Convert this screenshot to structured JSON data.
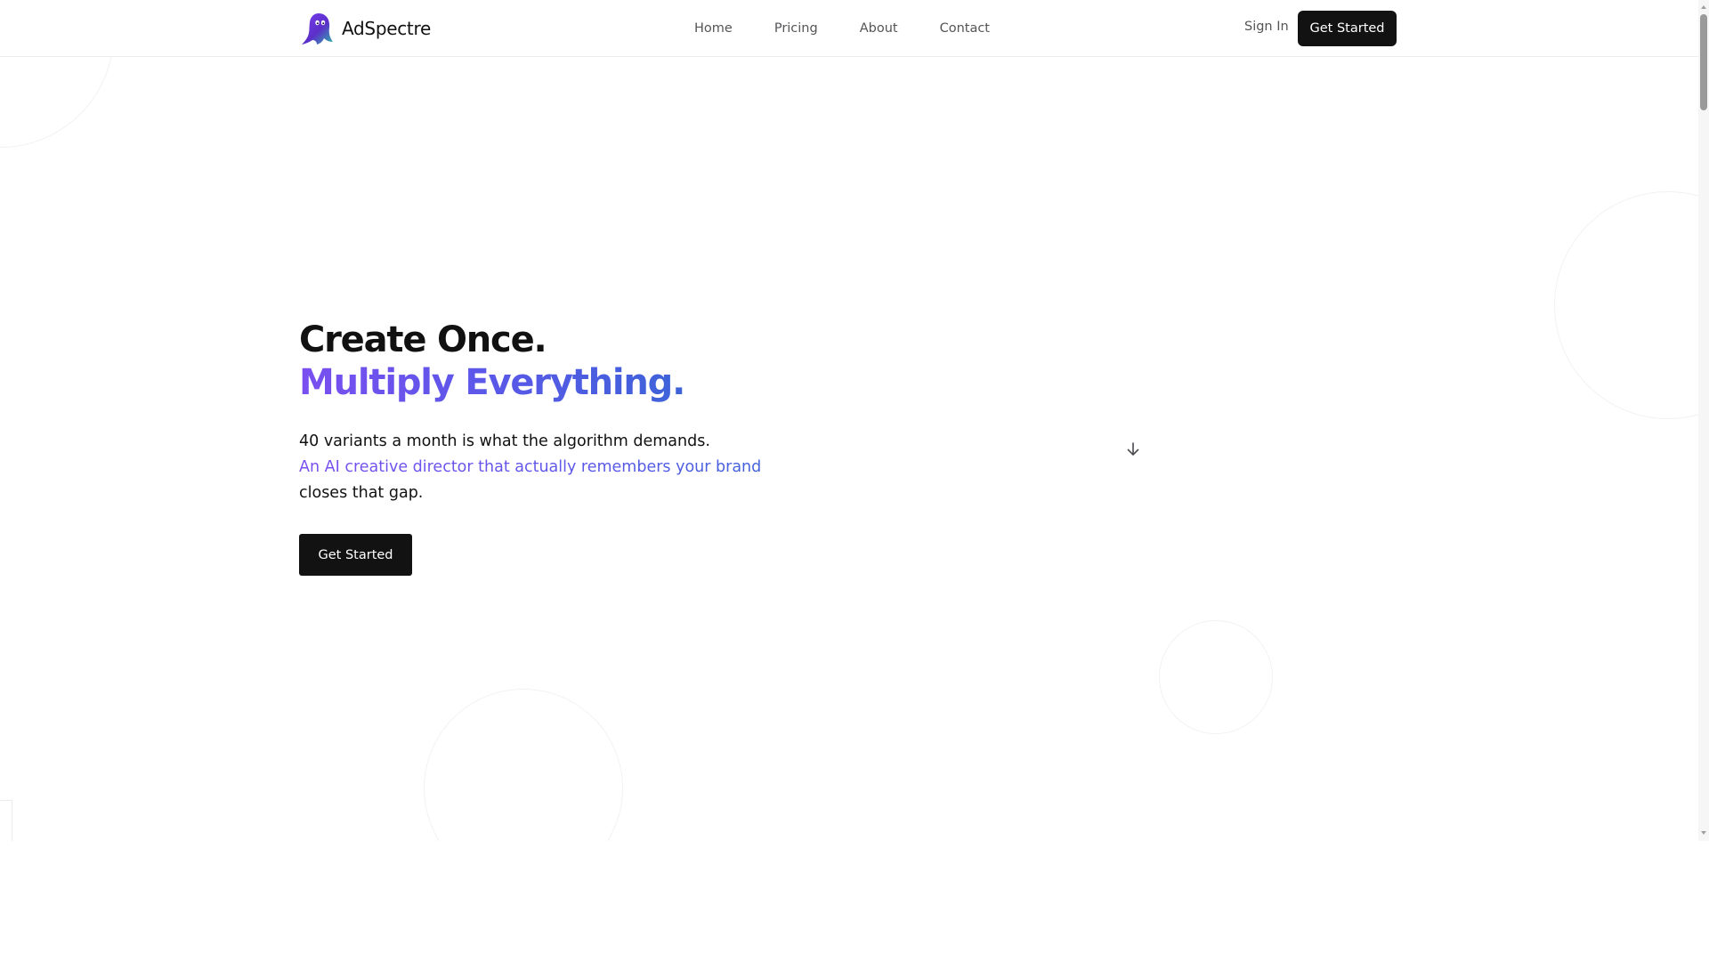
{
  "brand": {
    "name": "AdSpectre",
    "logo_icon": "ghost-logo-icon",
    "colors": {
      "accent_start": "#7a4ff0",
      "accent_end": "#3d63d8",
      "button_bg": "#121212",
      "page_bg": "#ffffff"
    }
  },
  "header": {
    "nav": [
      {
        "label": "Home"
      },
      {
        "label": "Pricing"
      },
      {
        "label": "About"
      },
      {
        "label": "Contact"
      }
    ],
    "sign_in_label": "Sign In",
    "cta_label": "Get Started"
  },
  "hero": {
    "title_line1": "Create Once.",
    "title_line2": "Multiply Everything.",
    "copy_line1": "40 variants a month is what the algorithm demands.",
    "copy_highlight": "An AI creative director that actually remembers your brand",
    "copy_line3": "closes that gap.",
    "cta_label": "Get Started",
    "scroll_icon": "arrow-down-icon"
  }
}
